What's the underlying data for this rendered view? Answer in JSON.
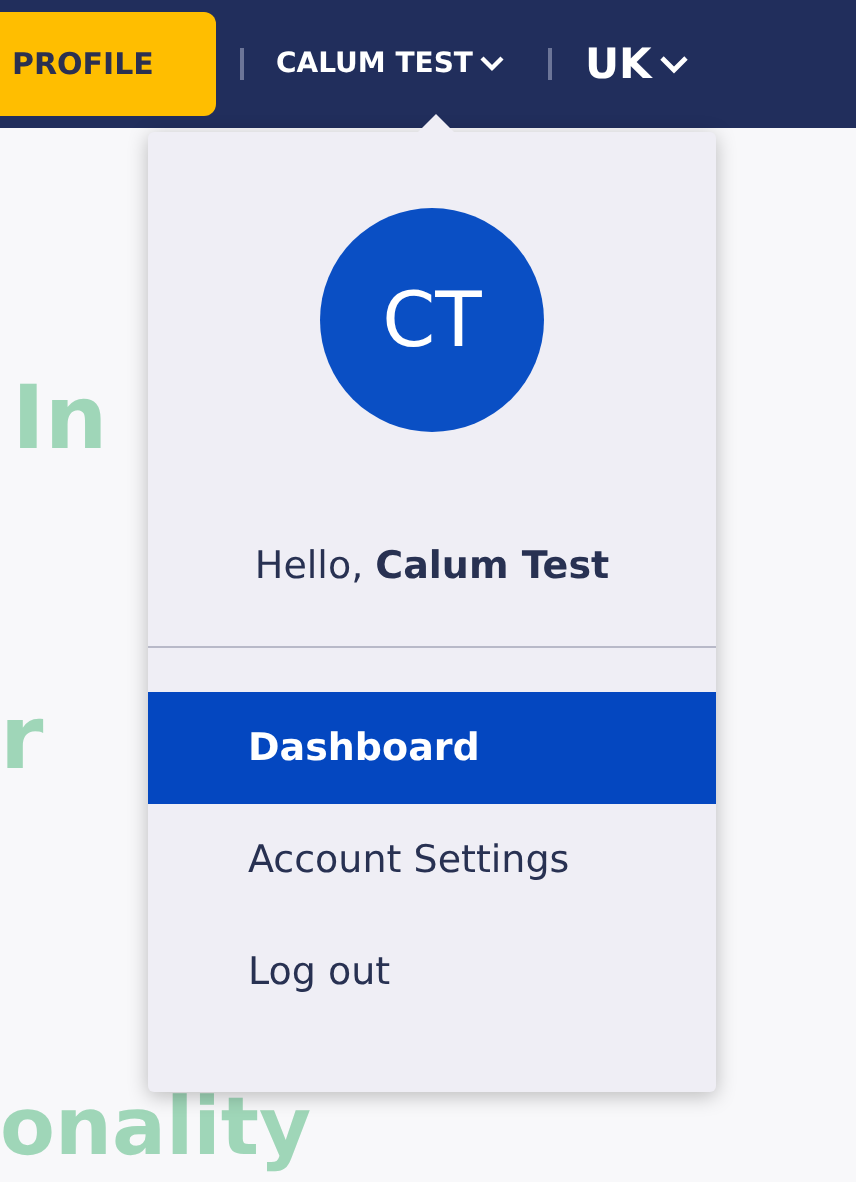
{
  "header": {
    "profile_button": "PROFILE",
    "user_menu": {
      "label": "CALUM TEST",
      "expanded": true
    },
    "region": {
      "label": "UK"
    }
  },
  "background_texts": [
    "In",
    "r",
    "onality"
  ],
  "user_dropdown": {
    "avatar_initials": "CT",
    "greeting": "Hello, **Calum Test**",
    "items": [
      {
        "label": "Dashboard",
        "selected": true
      },
      {
        "label": "Account Settings",
        "selected": false
      },
      {
        "label": "Log out",
        "selected": false
      }
    ]
  }
}
